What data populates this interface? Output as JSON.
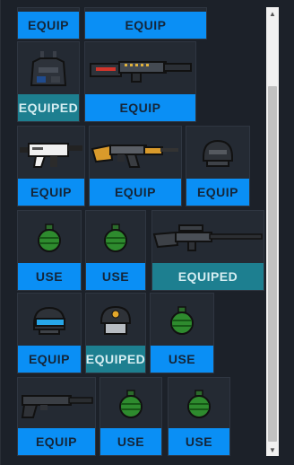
{
  "inventory": {
    "rows": [
      [
        {
          "item": "none",
          "button": "EQUIP",
          "state": "equip"
        },
        {
          "item": "none",
          "button": "EQUIP",
          "state": "equip"
        }
      ],
      [
        {
          "item": "vest-icon",
          "button": "EQUIPED",
          "state": "equiped"
        },
        {
          "item": "shotgun-icon",
          "button": "EQUIP",
          "state": "equip"
        }
      ],
      [
        {
          "item": "smg-icon",
          "button": "EQUIP",
          "state": "equip"
        },
        {
          "item": "rifle-icon",
          "button": "EQUIP",
          "state": "equip"
        },
        {
          "item": "helmet-icon",
          "button": "EQUIP",
          "state": "equip"
        }
      ],
      [
        {
          "item": "grenade-icon",
          "button": "USE",
          "state": "use"
        },
        {
          "item": "grenade-icon",
          "button": "USE",
          "state": "use"
        },
        {
          "item": "sniper-icon",
          "button": "EQUIPED",
          "state": "equiped"
        }
      ],
      [
        {
          "item": "visor-helmet-icon",
          "button": "EQUIP",
          "state": "equip"
        },
        {
          "item": "badge-helmet-icon",
          "button": "EQUIPED",
          "state": "equiped"
        },
        {
          "item": "grenade-icon",
          "button": "USE",
          "state": "use"
        }
      ],
      [
        {
          "item": "pistol-icon",
          "button": "EQUIP",
          "state": "equip"
        },
        {
          "item": "grenade-icon",
          "button": "USE",
          "state": "use"
        },
        {
          "item": "grenade-icon",
          "button": "USE",
          "state": "use"
        }
      ]
    ]
  },
  "colors": {
    "equip": "#0a8ff5",
    "equiped": "#1d7f90",
    "panel": "#1c2129"
  }
}
